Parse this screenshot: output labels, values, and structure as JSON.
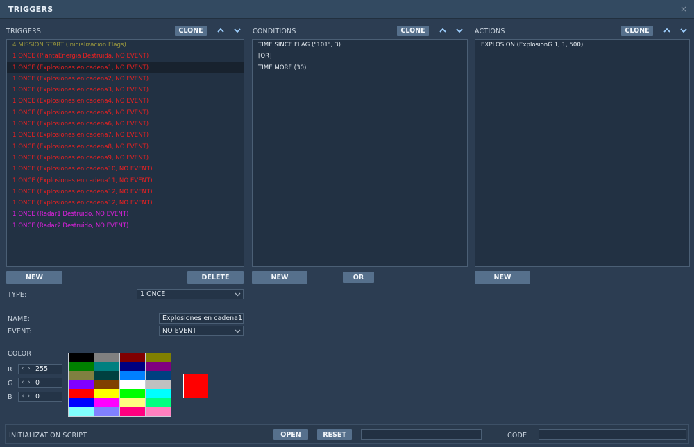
{
  "window": {
    "title": "TRIGGERS",
    "close": "×"
  },
  "triggers": {
    "header": "TRIGGERS",
    "clone_label": "CLONE",
    "items": [
      {
        "text": "4 MISSION START (Inicializacion Flags)",
        "color": "#9d9a3e"
      },
      {
        "text": "1 ONCE (PlantaEnergia Destruida, NO EVENT)",
        "color": "#ee2020"
      },
      {
        "text": "1 ONCE (Explosiones en cadena1, NO EVENT)",
        "color": "#ee2020",
        "selected": true
      },
      {
        "text": "1 ONCE (Explosiones en cadena2, NO EVENT)",
        "color": "#ee2020"
      },
      {
        "text": "1 ONCE (Explosiones en cadena3, NO EVENT)",
        "color": "#ee2020"
      },
      {
        "text": "1 ONCE (Explosiones en cadena4, NO EVENT)",
        "color": "#ee2020"
      },
      {
        "text": "1 ONCE (Explosiones en cadena5, NO EVENT)",
        "color": "#ee2020"
      },
      {
        "text": "1 ONCE (Explosiones en cadena6, NO EVENT)",
        "color": "#ee2020"
      },
      {
        "text": "1 ONCE (Explosiones en cadena7, NO EVENT)",
        "color": "#ee2020"
      },
      {
        "text": "1 ONCE (Explosiones en cadena8, NO EVENT)",
        "color": "#ee2020"
      },
      {
        "text": "1 ONCE (Explosiones en cadena9, NO EVENT)",
        "color": "#ee2020"
      },
      {
        "text": "1 ONCE (Explosiones en cadena10, NO EVENT)",
        "color": "#ee2020"
      },
      {
        "text": "1 ONCE (Explosiones en cadena11, NO EVENT)",
        "color": "#ee2020"
      },
      {
        "text": "1 ONCE (Explosiones en cadena12, NO EVENT)",
        "color": "#ee2020"
      },
      {
        "text": "1 ONCE (Explosiones en cadena12, NO EVENT)",
        "color": "#ee2020"
      },
      {
        "text": "1 ONCE (Radar1 Destruido, NO EVENT)",
        "color": "#e020e0"
      },
      {
        "text": "1 ONCE (Radar2 Destruido, NO EVENT)",
        "color": "#e020e0"
      }
    ],
    "new_label": "NEW",
    "delete_label": "DELETE"
  },
  "conditions": {
    "header": "CONDITIONS",
    "clone_label": "CLONE",
    "items": [
      "TIME SINCE FLAG (\"101\", 3)",
      "[OR]",
      "TIME MORE (30)"
    ],
    "new_label": "NEW",
    "or_label": "OR"
  },
  "actions": {
    "header": "ACTIONS",
    "clone_label": "CLONE",
    "items": [
      "EXPLOSION (ExplosionG 1, 1, 500)"
    ],
    "new_label": "NEW"
  },
  "form": {
    "type_label": "TYPE:",
    "type_value": "1 ONCE",
    "name_label": "NAME:",
    "name_value": "Explosiones en cadena1",
    "event_label": "EVENT:",
    "event_value": "NO EVENT"
  },
  "color": {
    "label": "COLOR",
    "r_label": "R",
    "r_value": "255",
    "g_label": "G",
    "g_value": "0",
    "b_label": "B",
    "b_value": "0",
    "preview": "#ff0000",
    "palette": [
      "#000000",
      "#808080",
      "#800000",
      "#808000",
      "#008000",
      "#008080",
      "#000080",
      "#800080",
      "#808040",
      "#004040",
      "#0080ff",
      "#004080",
      "#8000ff",
      "#804000",
      "#ffffff",
      "#c0c0c0",
      "#ff0000",
      "#ffff00",
      "#00ff00",
      "#00ffff",
      "#0000ff",
      "#ff00ff",
      "#ffff80",
      "#00ff80",
      "#80ffff",
      "#8080ff",
      "#ff0080",
      "#ff80c0"
    ]
  },
  "footer": {
    "init_label": "INITIALIZATION SCRIPT",
    "open_label": "OPEN",
    "reset_label": "RESET",
    "code_label": "CODE"
  }
}
